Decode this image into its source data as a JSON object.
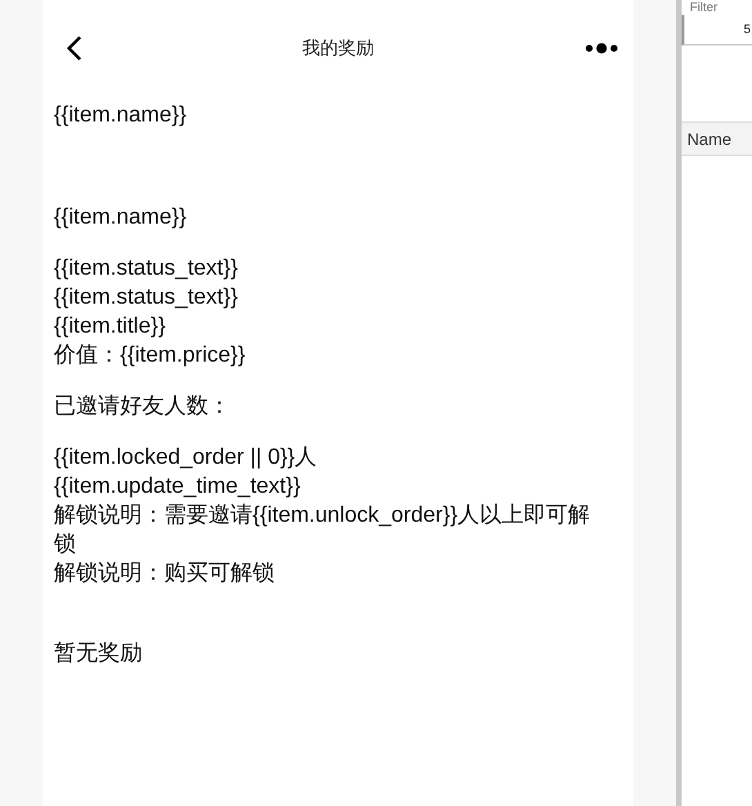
{
  "nav": {
    "title": "我的奖励"
  },
  "blocks": [
    {
      "lines": [
        "{{item.name}}"
      ]
    },
    {
      "lines": [
        "{{item.name}}"
      ]
    },
    {
      "lines": [
        "{{item.status_text}}",
        "{{item.status_text}}",
        "{{item.title}}",
        "价值：{{item.price}}"
      ]
    },
    {
      "lines": [
        "已邀请好友人数："
      ]
    },
    {
      "lines": [
        "{{item.locked_order || 0}}人",
        "{{item.update_time_text}}",
        "解锁说明：需要邀请{{item.unlock_order}}人以上即可解锁",
        "解锁说明：购买可解锁"
      ]
    }
  ],
  "empty_text": "暂无奖励",
  "devtools": {
    "filter_label": "Filter",
    "filter_value": "5",
    "column_header": "Name"
  }
}
